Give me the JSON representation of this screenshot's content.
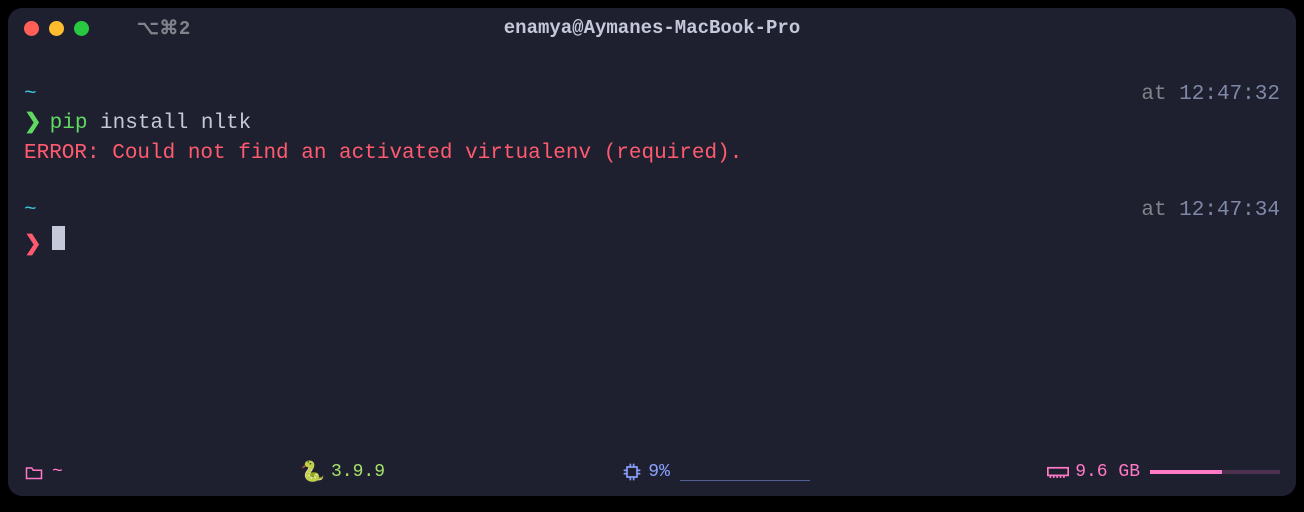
{
  "titlebar": {
    "tab_label": "⌥⌘2",
    "title": "enamya@Aymanes-MacBook-Pro"
  },
  "session": {
    "blocks": [
      {
        "cwd": "~",
        "at_label": "at",
        "time": "12:47:32",
        "prompt_color": "green",
        "command": {
          "name": "pip",
          "args": "install nltk"
        },
        "output": "ERROR: Could not find an activated virtualenv (required)."
      },
      {
        "cwd": "~",
        "at_label": "at",
        "time": "12:47:34",
        "prompt_color": "red",
        "command": {
          "name": "",
          "args": ""
        },
        "output": ""
      }
    ]
  },
  "statusbar": {
    "cwd": "~",
    "python_version": "3.9.9",
    "cpu_pct": "9%",
    "memory": "9.6 GB"
  }
}
